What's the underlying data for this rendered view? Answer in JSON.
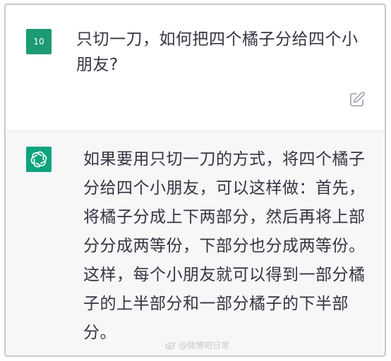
{
  "user_message": {
    "avatar_label": "10",
    "text": "只切一刀，如何把四个橘子分给四个小朋友?"
  },
  "assistant_message": {
    "text": "如果要用只切一刀的方式，将四个橘子分给四个小朋友，可以这样做：首先，将橘子分成上下两部分，然后再将上部分分成两等份，下部分也分成两等份。这样，每个小朋友就可以得到一部分橘子的上半部分和一部分橘子的下半部分。"
  },
  "icons": {
    "edit": "edit-icon",
    "bot": "openai-logo-icon",
    "weibo": "weibo-icon"
  },
  "colors": {
    "user_avatar_bg": "#1c9a73",
    "bot_avatar_bg": "#10a37f",
    "assistant_bg": "#f7f7f8",
    "text": "#343541"
  },
  "watermark": "@微博吧日常"
}
